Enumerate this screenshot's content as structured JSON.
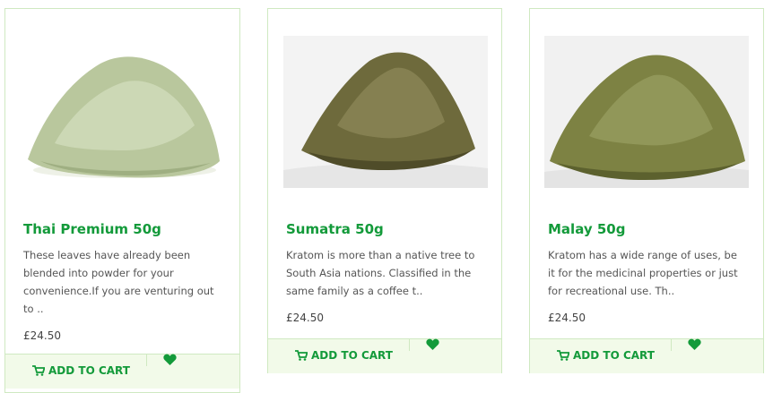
{
  "products": [
    {
      "name": "Thai Premium 50g",
      "description": "These leaves have already been blended into powder for your convenience.If you are venturing out to ..",
      "price": "£24.50",
      "add_to_cart_label": "ADD TO CART",
      "image_colors": {
        "main": "#b9c79d",
        "shadow": "#9faf82",
        "light": "#d3ddbd"
      }
    },
    {
      "name": "Sumatra 50g",
      "description": "Kratom is more than a native tree to South Asia nations. Classified in the same family as a coffee t..",
      "price": "£24.50",
      "add_to_cart_label": "ADD TO CART",
      "image_colors": {
        "main": "#6e6a3c",
        "shadow": "#4f4c29",
        "light": "#8f8a5a"
      }
    },
    {
      "name": "Malay 50g",
      "description": "Kratom has a wide range of uses, be it for the medicinal properties or just for recreational use. Th..",
      "price": "£24.50",
      "add_to_cart_label": "ADD TO CART",
      "image_colors": {
        "main": "#7d8243",
        "shadow": "#5c612e",
        "light": "#9aa062"
      }
    }
  ],
  "theme": {
    "accent": "#139a3a",
    "border": "#cfe9c1",
    "action_bg": "#f2fae9"
  },
  "icons": {
    "cart": "shopping-cart-icon",
    "wishlist": "heart-icon"
  }
}
